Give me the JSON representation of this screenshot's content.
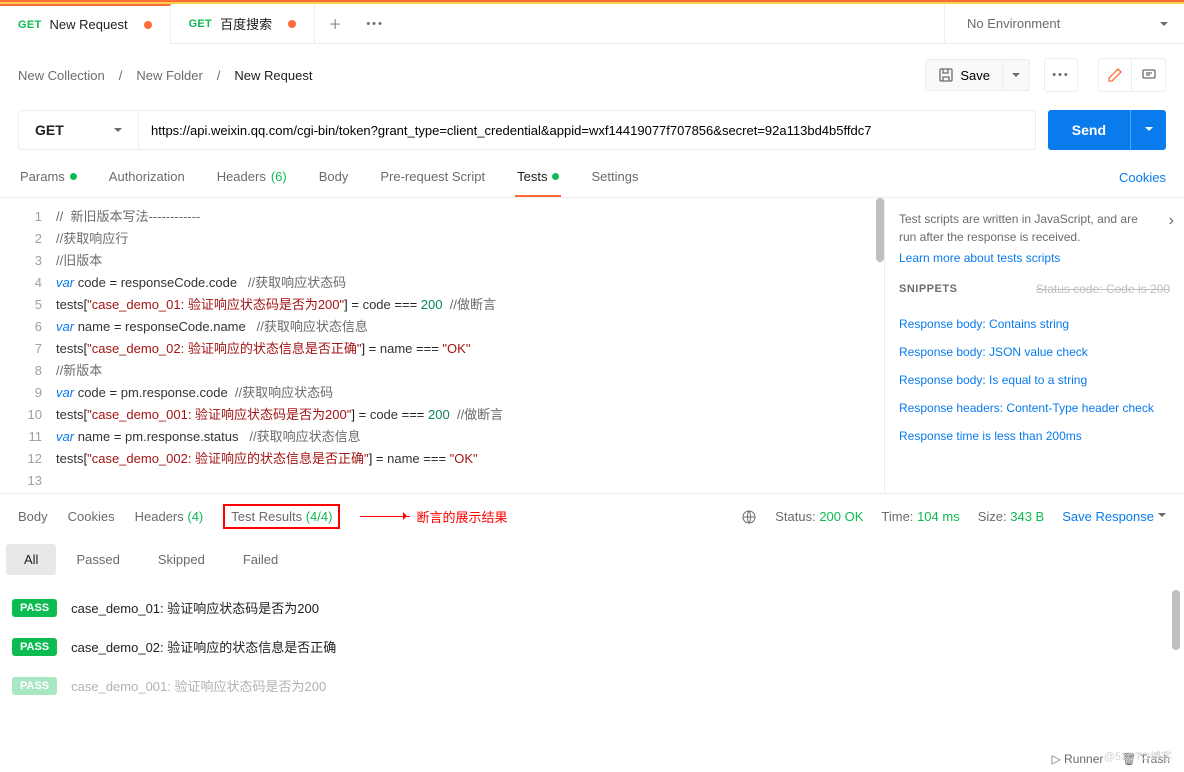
{
  "tabs": [
    {
      "method": "GET",
      "title": "New Request"
    },
    {
      "method": "GET",
      "title": "百度搜索"
    }
  ],
  "env": "No Environment",
  "breadcrumbs": {
    "a": "New Collection",
    "sep": "/",
    "b": "New Folder",
    "c": "New Request"
  },
  "saveBtn": "Save",
  "method": "GET",
  "url": "https://api.weixin.qq.com/cgi-bin/token?grant_type=client_credential&appid=wxf14419077f707856&secret=92a113bd4b5ffdc7",
  "send": "Send",
  "reqTabs": {
    "params": "Params",
    "auth": "Authorization",
    "headers": "Headers",
    "hcount": "(6)",
    "body": "Body",
    "pre": "Pre-request Script",
    "tests": "Tests",
    "settings": "Settings",
    "cookies": "Cookies"
  },
  "sidebar": {
    "desc": "Test scripts are written in JavaScript, and are run after the response is received.",
    "learn": "Learn more about tests scripts",
    "sniph": "SNIPPETS",
    "strike": "Status code: Code is 200",
    "snips": [
      "Response body: Contains string",
      "Response body: JSON value check",
      "Response body: Is equal to a string",
      "Response headers: Content-Type header check",
      "Response time is less than 200ms"
    ]
  },
  "respTabs": {
    "body": "Body",
    "cookies": "Cookies",
    "headers": "Headers",
    "hcount": "(4)",
    "tr": "Test Results",
    "trcount": "(4/4)"
  },
  "annot": "断言的展示结果",
  "status": {
    "sl": "Status:",
    "sv": "200 OK",
    "tl": "Time:",
    "tv": "104 ms",
    "szl": "Size:",
    "szv": "343 B",
    "save": "Save Response"
  },
  "filters": {
    "all": "All",
    "passed": "Passed",
    "skipped": "Skipped",
    "failed": "Failed"
  },
  "pass": "PASS",
  "results": [
    "case_demo_01: 验证响应状态码是否为200",
    "case_demo_02: 验证响应的状态信息是否正确",
    "case_demo_001: 验证响应状态码是否为200"
  ],
  "footer": {
    "runner": "Runner",
    "trash": "Trash"
  },
  "wm": "@51CTO博客"
}
